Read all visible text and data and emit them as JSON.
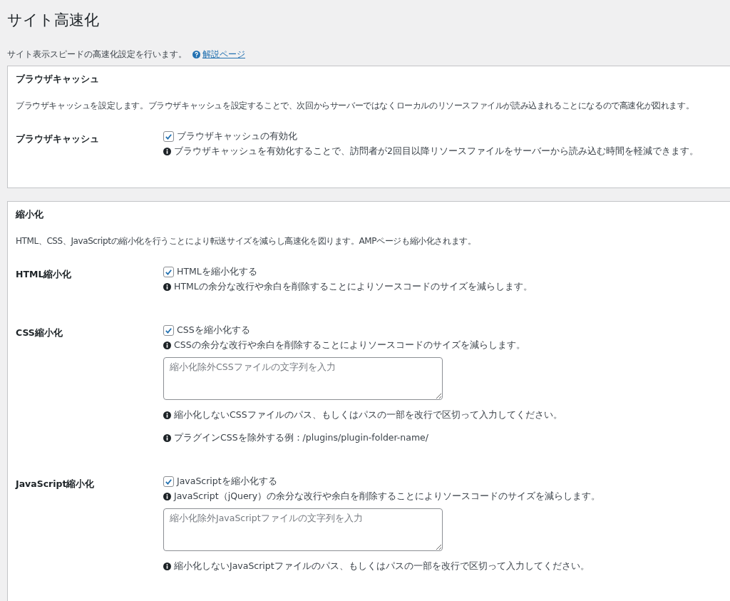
{
  "page": {
    "title": "サイト高速化",
    "description": "サイト表示スピードの高速化設定を行います。",
    "help_link": "解説ページ"
  },
  "sections": [
    {
      "title": "ブラウザキャッシュ",
      "description": "ブラウザキャッシュを設定します。ブラウザキャッシュを設定することで、次回からサーバーではなくローカルのリソースファイルが読み込まれることになるので高速化が図れます。",
      "settings": [
        {
          "label": "ブラウザキャッシュ",
          "items": [
            {
              "kind": "checkbox",
              "label": "ブラウザキャッシュの有効化",
              "checked": true
            },
            {
              "kind": "note",
              "text": "ブラウザキャッシュを有効化することで、訪問者が2回目以降リソースファイルをサーバーから読み込む時間を軽減できます。"
            }
          ]
        }
      ]
    },
    {
      "title": "縮小化",
      "description": "HTML、CSS、JavaScriptの縮小化を行うことにより転送サイズを減らし高速化を図ります。AMPページも縮小化されます。",
      "settings": [
        {
          "label": "HTML縮小化",
          "items": [
            {
              "kind": "checkbox",
              "label": "HTMLを縮小化する",
              "checked": true
            },
            {
              "kind": "note",
              "text": "HTMLの余分な改行や余白を削除することによりソースコードのサイズを減らします。"
            }
          ]
        },
        {
          "label": "CSS縮小化",
          "items": [
            {
              "kind": "checkbox",
              "label": "CSSを縮小化する",
              "checked": true
            },
            {
              "kind": "note",
              "text": "CSSの余分な改行や余白を削除することによりソースコードのサイズを減らします。"
            },
            {
              "kind": "textarea",
              "placeholder": "縮小化除外CSSファイルの文字列を入力"
            },
            {
              "kind": "note",
              "text": "縮小化しないCSSファイルのパス、もしくはパスの一部を改行で区切って入力してください。"
            },
            {
              "kind": "note",
              "text": "プラグインCSSを除外する例：/plugins/plugin-folder-name/"
            }
          ]
        },
        {
          "label": "JavaScript縮小化",
          "items": [
            {
              "kind": "checkbox",
              "label": "JavaScriptを縮小化する",
              "checked": true
            },
            {
              "kind": "note",
              "text": "JavaScript（jQuery）の余分な改行や余白を削除することによりソースコードのサイズを減らします。"
            },
            {
              "kind": "textarea",
              "placeholder": "縮小化除外JavaScriptファイルの文字列を入力"
            },
            {
              "kind": "note",
              "text": "縮小化しないJavaScriptファイルのパス、もしくはパスの一部を改行で区切って入力してください。"
            }
          ]
        }
      ]
    }
  ]
}
